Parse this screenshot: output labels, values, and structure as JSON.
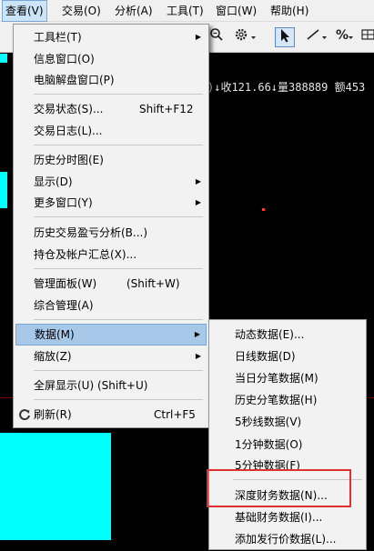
{
  "menubar": {
    "items": [
      {
        "label": "查看(V)"
      },
      {
        "label": "交易(O)"
      },
      {
        "label": "分析(A)"
      },
      {
        "label": "工具(T)"
      },
      {
        "label": "窗口(W)"
      },
      {
        "label": "帮助(H)"
      }
    ]
  },
  "toolbar": {
    "zoom_icon": "zoom-icon",
    "gear_icon": "gear-icon",
    "cursor_icon": "cursor-icon",
    "line_icon": "line-tool-icon",
    "percent_icon": "percent-icon",
    "grid_icon": "grid-icon"
  },
  "chart": {
    "quote_text": ")↓收121.66↓量388889 额453"
  },
  "main_menu": {
    "items": [
      {
        "label": "工具栏(T)",
        "submenu": true
      },
      {
        "label": "信息窗口(O)"
      },
      {
        "label": "电脑解盘窗口(P)"
      },
      {
        "label": "交易状态(S)...",
        "shortcut": "Shift+F12"
      },
      {
        "label": "交易日志(L)..."
      },
      {
        "label": "历史分时图(E)"
      },
      {
        "label": "显示(D)",
        "submenu": true
      },
      {
        "label": "更多窗口(Y)",
        "submenu": true
      },
      {
        "label": "历史交易盈亏分析(B...)"
      },
      {
        "label": "持仓及帐户汇总(X)..."
      },
      {
        "label": "管理面板(W)",
        "shortcut": "(Shift+W)"
      },
      {
        "label": "综合管理(A)"
      },
      {
        "label": "数据(M)",
        "submenu": true
      },
      {
        "label": "缩放(Z)",
        "submenu": true
      },
      {
        "label": "全屏显示(U) (Shift+U)"
      },
      {
        "label": "刷新(R)",
        "shortcut": "Ctrl+F5"
      }
    ]
  },
  "data_submenu": {
    "items": [
      {
        "label": "动态数据(E)..."
      },
      {
        "label": "日线数据(D)"
      },
      {
        "label": "当日分笔数据(M)"
      },
      {
        "label": "历史分笔数据(H)"
      },
      {
        "label": "5秒线数据(V)"
      },
      {
        "label": "1分钟数据(O)"
      },
      {
        "label": "5分钟数据(F)"
      },
      {
        "label": "深度财务数据(N)..."
      },
      {
        "label": "基础财务数据(I)..."
      },
      {
        "label": "添加发行价数据(L)..."
      }
    ]
  },
  "colors": {
    "menu_highlight": "#a8c8ea",
    "annotation_box": "#e03030",
    "chart_bg": "#000000",
    "cyan": "#00ffff"
  }
}
